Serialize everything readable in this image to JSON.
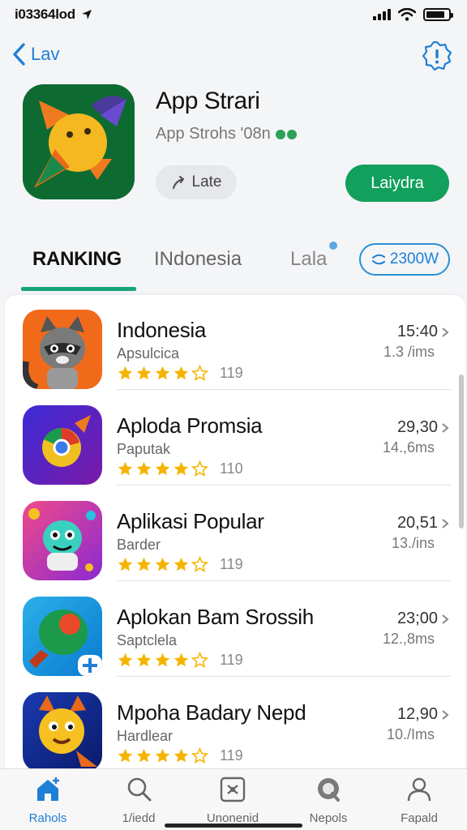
{
  "status_bar": {
    "time": "i03364lod",
    "colors": {
      "icons": "#111111"
    },
    "battery_level": 0.85
  },
  "nav": {
    "back_label": "Lav",
    "icons": {
      "back": "chevron-left-icon",
      "badge": "badge-icon"
    }
  },
  "app": {
    "title": "App Strari",
    "subtitle": "App Strohs '08n",
    "share_label": "Late",
    "get_label": "Laiydra",
    "colors": {
      "accent": "#12a05c",
      "link": "#1e7fd6"
    }
  },
  "tabs": {
    "items": [
      {
        "label": "RANKING",
        "active": true
      },
      {
        "label": "INdonesia",
        "active": false
      },
      {
        "label": "Lala",
        "active": false
      }
    ],
    "pill_label": "2300W"
  },
  "list": {
    "items": [
      {
        "name": "Indonesia",
        "sub": "Apsulcica",
        "rating": 4,
        "count": "119",
        "size": "15:40",
        "size_sub": "1.3 /ims"
      },
      {
        "name": "Aploda Promsia",
        "sub": "Paputak",
        "rating": 4,
        "count": "110",
        "size": "29,30",
        "size_sub": "14.,6ms"
      },
      {
        "name": "Aplikasi Popular",
        "sub": "Barder",
        "rating": 4,
        "count": "119",
        "size": "20,51",
        "size_sub": "13./ins"
      },
      {
        "name": "Aplokan Bam Srossih",
        "sub": "Saptclela",
        "rating": 4,
        "count": "119",
        "size": "23;00",
        "size_sub": "12.,8ms"
      },
      {
        "name": "Mpoha Badary Nepd",
        "sub": "Hardlear",
        "rating": 4,
        "count": "119",
        "size": "12,90",
        "size_sub": "10./Ims"
      }
    ]
  },
  "bottom_bar": {
    "items": [
      {
        "label": "Rahols",
        "icon": "home-icon",
        "active": true
      },
      {
        "label": "1/iedd",
        "icon": "search-icon",
        "active": false
      },
      {
        "label": "Unonenid",
        "icon": "apps-icon",
        "active": false
      },
      {
        "label": "Nepols",
        "icon": "updates-icon",
        "active": false
      },
      {
        "label": "Fapald",
        "icon": "profile-icon",
        "active": false
      }
    ]
  }
}
